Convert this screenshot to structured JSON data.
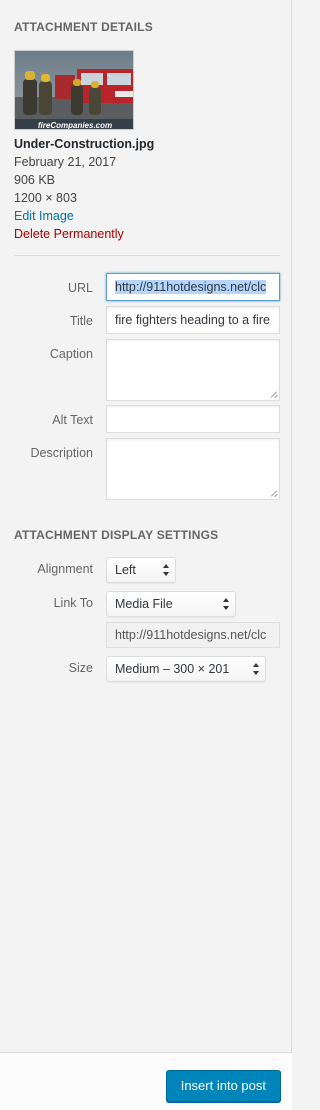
{
  "details": {
    "heading": "ATTACHMENT DETAILS",
    "thumbnail_caption": "fireCompanies.com",
    "filename": "Under-Construction.jpg",
    "date": "February 21, 2017",
    "filesize": "906 KB",
    "dimensions": "1200 × 803",
    "edit_label": "Edit Image",
    "delete_label": "Delete Permanently"
  },
  "fields": {
    "url_label": "URL",
    "url_value": "http://911hotdesigns.net/clc",
    "title_label": "Title",
    "title_value": "fire fighters heading to a fire",
    "caption_label": "Caption",
    "caption_value": "",
    "alt_label": "Alt Text",
    "alt_value": "",
    "description_label": "Description",
    "description_value": ""
  },
  "display": {
    "heading": "ATTACHMENT DISPLAY SETTINGS",
    "alignment_label": "Alignment",
    "alignment_value": "Left",
    "linkto_label": "Link To",
    "linkto_value": "Media File",
    "link_url": "http://911hotdesigns.net/clc",
    "size_label": "Size",
    "size_value": "Medium – 300 × 201"
  },
  "footer": {
    "insert_label": "Insert into post"
  },
  "colors": {
    "link": "#0073aa",
    "danger": "#a00",
    "primary": "#0085ba"
  }
}
